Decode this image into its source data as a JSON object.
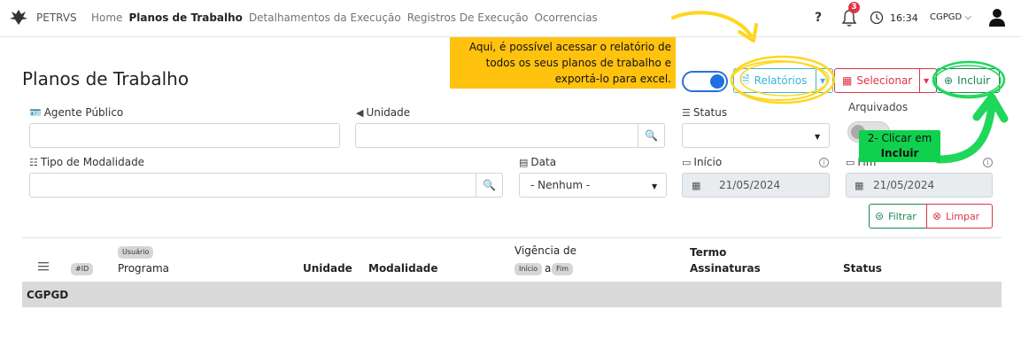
{
  "nav": {
    "brand": "PETRVS",
    "items": [
      {
        "label": "Home",
        "active": false
      },
      {
        "label": "Planos de Trabalho",
        "active": true
      },
      {
        "label": "Detalhamentos da Execução",
        "active": false
      },
      {
        "label": "Registros De Execução",
        "active": false
      },
      {
        "label": "Ocorrencias",
        "active": false
      }
    ],
    "help": "?",
    "notification_count": "3",
    "time": "16:34",
    "unit": "CGPGD",
    "unit_caret": "⌵"
  },
  "page": {
    "title": "Planos de Trabalho"
  },
  "toolbar": {
    "reports_label": "Relatórios",
    "select_label": "Selecionar",
    "add_label": "Incluir"
  },
  "filters": {
    "agent_label": "Agente Público",
    "unit_label": "Unidade",
    "status_label": "Status",
    "archived_label": "Arquivados",
    "modality_label": "Tipo de Modalidade",
    "date_label": "Data",
    "date_value": "- Nenhum -",
    "start_label": "Início",
    "start_value": "21/05/2024",
    "end_label": "Fim",
    "end_value": "21/05/2024",
    "filter_button": "Filtrar",
    "clear_button": "Limpar"
  },
  "table": {
    "col_id_badge": "#ID",
    "user_badge": "Usuário",
    "col_program": "Programa",
    "col_unit": "Unidade",
    "col_modality": "Modalidade",
    "col_validity": "Vigência de",
    "validity_start_badge": "Início",
    "validity_sep": "a",
    "validity_end_badge": "Fim",
    "col_term": "Termo",
    "col_signatures": "Assinaturas",
    "col_status": "Status",
    "group": "CGPGD"
  },
  "annotations": {
    "callout_reports": [
      "Aqui, é possível acessar o relatório de",
      "todos os seus planos de trabalho e",
      "exportá-lo para excel."
    ],
    "callout_add_line1": "2- Clicar em",
    "callout_add_line2": "Incluir",
    "highlight_color": "#ffd61f",
    "highlight_green": "#1fd75a"
  }
}
